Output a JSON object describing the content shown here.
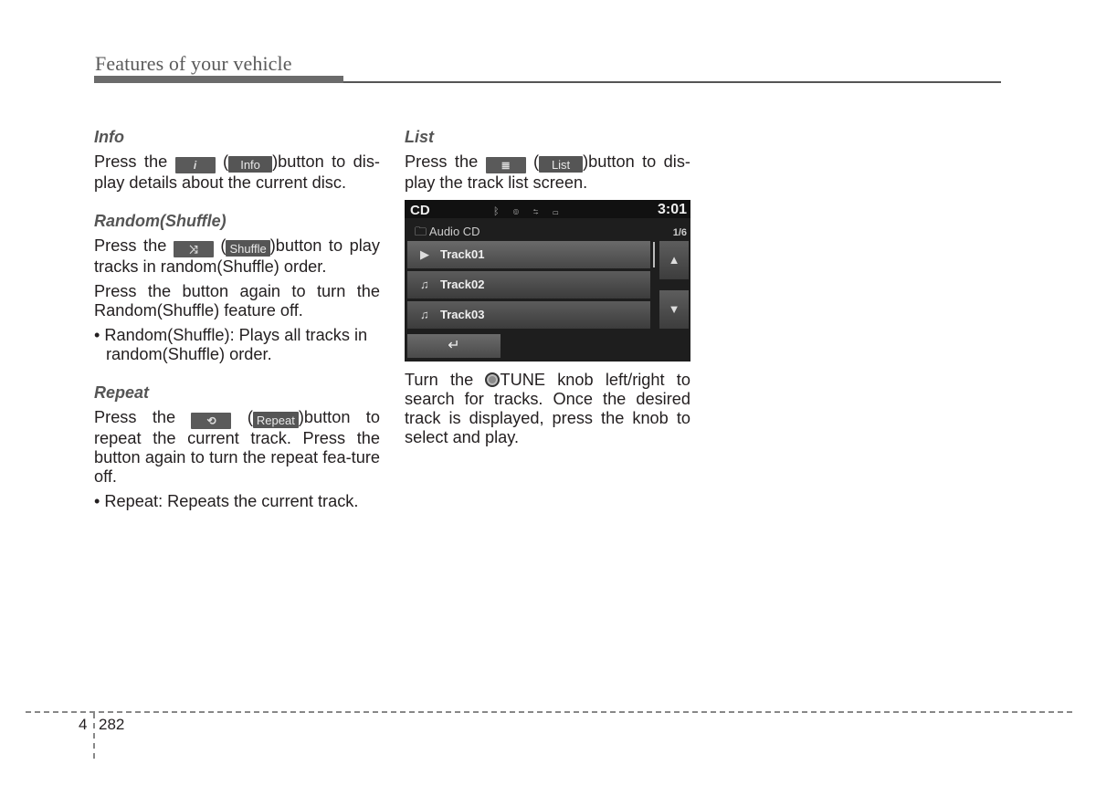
{
  "header": {
    "title": "Features of your vehicle"
  },
  "left_column": {
    "info": {
      "heading": "Info",
      "text_before": "Press the ",
      "hw_button_glyph": "i",
      "hw_button_icon": "info-icon",
      "open_paren": " (",
      "sw_button_label": "Info",
      "text_after": ")button to dis-play details about the current disc."
    },
    "shuffle": {
      "heading": "Random(Shuffle)",
      "text_before": "Press the ",
      "hw_button_glyph": "⤨",
      "hw_button_icon": "shuffle-icon",
      "open_paren": " (",
      "sw_button_label": "Shuffle",
      "text_after": ")button to play tracks in random(Shuffle) order.",
      "para2": "Press the button again to turn the Random(Shuffle) feature off.",
      "bullet": "• Random(Shuffle): Plays all tracks in random(Shuffle) order."
    },
    "repeat": {
      "heading": "Repeat",
      "text_before": "Press the ",
      "hw_button_glyph": "⟲",
      "hw_button_icon": "repeat-icon",
      "open_paren": " (",
      "sw_button_label": "Repeat",
      "text_after": ")button to repeat the current track. Press the button again to turn the repeat fea-ture off.",
      "bullet": "• Repeat: Repeats the current track."
    }
  },
  "right_column": {
    "list": {
      "heading": "List",
      "text_before": "Press the ",
      "hw_button_glyph": "≣",
      "hw_button_icon": "list-icon",
      "open_paren": " (",
      "sw_button_label": "List",
      "text_after": ")button to dis-play the track list screen."
    },
    "screen": {
      "mode": "CD",
      "status_icons": "ᛒ ◎ ⇆ ▭",
      "time": "3:01",
      "folder_icon": "🗀",
      "folder_name": "Audio CD",
      "count": "1/6",
      "tracks": [
        {
          "icon": "▶",
          "icon_name": "play-circle-icon",
          "name": "Track01",
          "active": true
        },
        {
          "icon": "♫",
          "icon_name": "music-note-icon",
          "name": "Track02",
          "active": false
        },
        {
          "icon": "♫",
          "icon_name": "music-note-icon",
          "name": "Track03",
          "active": false
        }
      ],
      "up_arrow": "▲",
      "down_arrow": "▼",
      "back_glyph": "↵"
    },
    "tune_text_before": "Turn the ",
    "tune_text_after": "TUNE knob left/right to search for tracks. Once the desired track is displayed, press the knob to select and play."
  },
  "footer": {
    "chapter": "4",
    "page": "282"
  }
}
